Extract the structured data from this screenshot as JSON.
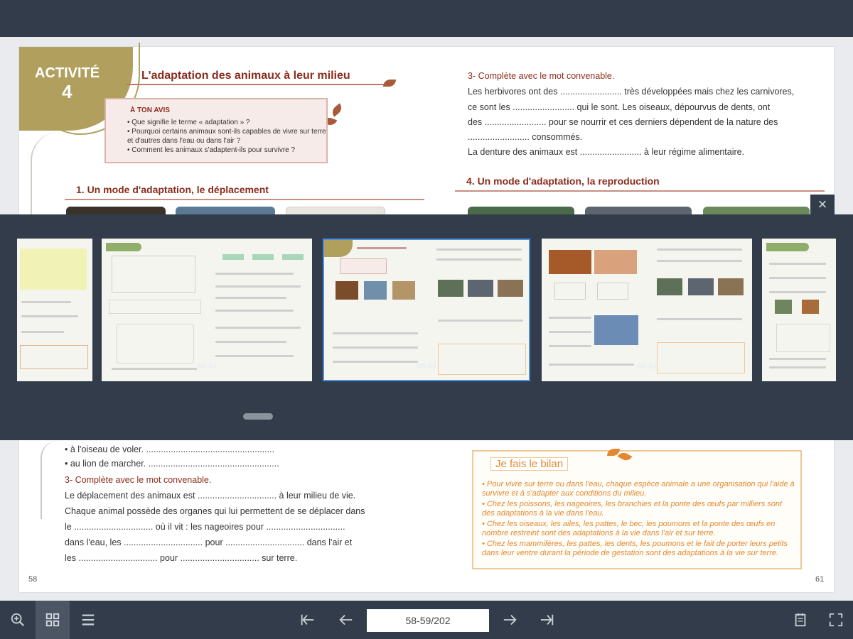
{
  "spread": {
    "left": {
      "activity_word": "ACTIVITÉ",
      "activity_number": "4",
      "title": "L'adaptation des animaux à leur milieu",
      "ton_avis_heading": "À TON AVIS",
      "ton_avis_items": [
        "Que signifie le terme « adaptation » ?",
        "Pourquoi certains animaux sont-ils capables de vivre sur terre et d'autres dans l'eau ou dans l'air ?",
        "Comment les animaux s'adaptent-ils pour survivre ?"
      ],
      "section1_title": "1. Un mode d'adaptation, le déplacement",
      "lower_lines": [
        "• à l'oiseau de voler. ....................................................",
        "• au lion de marcher. .....................................................",
        "Le déplacement des animaux est ................................ à leur milieu de vie.",
        "Chaque animal possède des organes qui lui permettent de se déplacer dans",
        "le ................................ où il vit : les nageoires pour ................................",
        "dans l'eau, les ................................ pour ................................ dans l'air et",
        "les ................................ pour ................................ sur terre."
      ],
      "complete_heading": "3- Complète avec le mot convenable.",
      "page_number": "58"
    },
    "right": {
      "complete_heading": "3- Complète avec le mot convenable.",
      "lines": [
        "Les herbivores ont des ......................... très développées mais chez les carnivores,",
        "ce sont les ......................... qui le sont. Les oiseaux, dépourvus de dents, ont",
        "des ......................... pour se nourrir et ces derniers dépendent de la nature des",
        "......................... consommés.",
        "La denture des animaux est ......................... à leur régime alimentaire."
      ],
      "section4_title": "4. Un mode d'adaptation, la reproduction",
      "bilan_title": "Je fais le bilan",
      "bilan_items": [
        "Pour vivre sur terre ou dans l'eau, chaque espèce animale a une organisation qui l'aide à survivre et à s'adapter aux conditions du milieu.",
        "Chez les poissons, les nageoires, les branchies et la ponte des œufs par milliers sont des adaptations à la vie dans l'eau.",
        "Chez les oiseaux, les ailes, les pattes, le bec, les poumons et la ponte des œufs en nombre restreint sont des adaptations à la vie dans l'air et sur terre.",
        "Chez les mammifères, les pattes, les dents, les poumons et le fait de porter leurs petits dans leur ventre durant la période de gestation sont des adaptations à la vie sur terre."
      ],
      "page_number": "61"
    }
  },
  "thumbnails": {
    "close_icon": "×",
    "items": [
      {
        "label": "",
        "active": false
      },
      {
        "label": "56-57",
        "active": false
      },
      {
        "label": "58-59",
        "active": true
      },
      {
        "label": "60-61",
        "active": false
      },
      {
        "label": "",
        "active": false
      }
    ]
  },
  "toolbar": {
    "zoom_icon": "zoom-in-icon",
    "grid_icon": "grid-icon",
    "list_icon": "list-icon",
    "first_icon": "first-page-icon",
    "prev_icon": "previous-page-icon",
    "page_value": "58-59/202",
    "next_icon": "next-page-icon",
    "last_icon": "last-page-icon",
    "notes_icon": "notes-icon",
    "fullscreen_icon": "fullscreen-icon",
    "active_color": "#4b5564",
    "bar_color": "#323c4a"
  }
}
